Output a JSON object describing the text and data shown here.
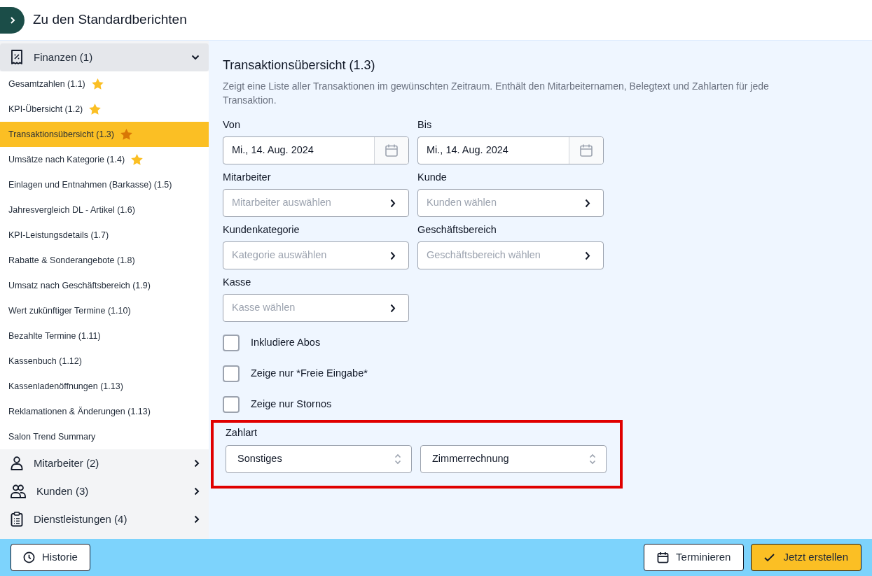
{
  "header": {
    "back_label": "Zu den Standardberichten"
  },
  "sidebar": {
    "groups": [
      {
        "kind": "finance",
        "label": "Finanzen (1)",
        "expanded": true,
        "items": [
          {
            "label": "Gesamtzahlen (1.1)",
            "starred": true,
            "selected": false
          },
          {
            "label": "KPI-Übersicht (1.2)",
            "starred": true,
            "selected": false
          },
          {
            "label": "Transaktionsübersicht (1.3)",
            "starred": true,
            "selected": true
          },
          {
            "label": "Umsätze nach Kategorie (1.4)",
            "starred": true,
            "selected": false
          },
          {
            "label": "Einlagen und Entnahmen (Barkasse) (1.5)",
            "starred": false,
            "selected": false
          },
          {
            "label": "Jahresvergleich DL - Artikel (1.6)",
            "starred": false,
            "selected": false
          },
          {
            "label": "KPI-Leistungsdetails (1.7)",
            "starred": false,
            "selected": false
          },
          {
            "label": "Rabatte & Sonderangebote (1.8)",
            "starred": false,
            "selected": false
          },
          {
            "label": "Umsatz nach Geschäftsbereich (1.9)",
            "starred": false,
            "selected": false
          },
          {
            "label": "Wert zukünftiger Termine (1.10)",
            "starred": false,
            "selected": false
          },
          {
            "label": "Bezahlte Termine (1.11)",
            "starred": false,
            "selected": false
          },
          {
            "label": "Kassenbuch (1.12)",
            "starred": false,
            "selected": false
          },
          {
            "label": "Kassenladenöffnungen (1.13)",
            "starred": false,
            "selected": false
          },
          {
            "label": "Reklamationen & Änderungen (1.13)",
            "starred": false,
            "selected": false
          },
          {
            "label": "Salon Trend Summary",
            "starred": false,
            "selected": false
          }
        ]
      },
      {
        "kind": "staff",
        "label": "Mitarbeiter (2)",
        "expanded": false
      },
      {
        "kind": "customers",
        "label": "Kunden (3)",
        "expanded": false
      },
      {
        "kind": "services",
        "label": "Dienstleistungen (4)",
        "expanded": false
      }
    ]
  },
  "report": {
    "title": "Transaktionsübersicht (1.3)",
    "description": "Zeigt eine Liste aller Transaktionen im gewünschten Zeitraum. Enthält den Mitarbeiternamen, Belegtext und Zahlarten für jede Transaktion.",
    "field_rows": [
      [
        {
          "kind": "date",
          "label": "Von",
          "value": "Mi., 14. Aug. 2024"
        },
        {
          "kind": "date",
          "label": "Bis",
          "value": "Mi., 14. Aug. 2024"
        }
      ],
      [
        {
          "kind": "picker",
          "label": "Mitarbeiter",
          "placeholder": "Mitarbeiter auswählen"
        },
        {
          "kind": "picker",
          "label": "Kunde",
          "placeholder": "Kunden wählen"
        }
      ],
      [
        {
          "kind": "picker",
          "label": "Kundenkategorie",
          "placeholder": "Kategorie auswählen"
        },
        {
          "kind": "picker",
          "label": "Geschäftsbereich",
          "placeholder": "Geschäftsbereich wählen"
        }
      ],
      [
        {
          "kind": "picker",
          "label": "Kasse",
          "placeholder": "Kasse wählen"
        }
      ]
    ],
    "checkboxes": [
      {
        "label": "Inkludiere Abos",
        "checked": false
      },
      {
        "label": "Zeige nur *Freie Eingabe*",
        "checked": false
      },
      {
        "label": "Zeige nur Stornos",
        "checked": false
      }
    ],
    "payment": {
      "label": "Zahlart",
      "highlighted": true,
      "selects": [
        {
          "value": "Sonstiges"
        },
        {
          "value": "Zimmerrechnung"
        }
      ]
    }
  },
  "footer": {
    "history_button": "Historie",
    "schedule_button": "Terminieren",
    "create_button": "Jetzt erstellen"
  }
}
